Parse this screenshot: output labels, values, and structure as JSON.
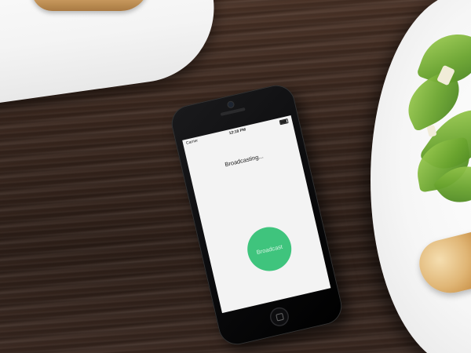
{
  "scene": {
    "description_icons": [
      "plate",
      "salad",
      "bread",
      "smartphone"
    ]
  },
  "phone": {
    "status_bar": {
      "carrier": "Carrier",
      "time": "12:18 PM"
    },
    "screen": {
      "status_text": "Broadcasting...",
      "broadcast_button_label": "Broadcast",
      "accent_color": "#3fc47d"
    }
  }
}
